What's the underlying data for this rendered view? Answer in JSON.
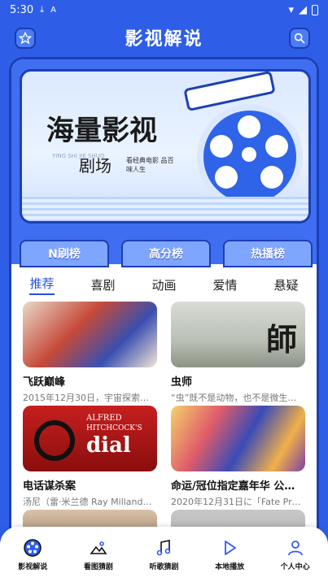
{
  "status": {
    "time": "5:30"
  },
  "header": {
    "title": "影视解说"
  },
  "banner": {
    "title": "海量影视",
    "subtitle": "剧场",
    "small": "看经典电影 品百味人生",
    "en": "YING SHI JIE SHUO"
  },
  "ranks": [
    {
      "label": "N刷榜"
    },
    {
      "label": "高分榜"
    },
    {
      "label": "热播榜"
    }
  ],
  "tabs": [
    "推荐",
    "喜剧",
    "动画",
    "爱情",
    "悬疑"
  ],
  "items": [
    {
      "title": "飞跃巅峰",
      "desc": "2015年12月30日，宇宙探索船Lu…"
    },
    {
      "title": "虫师",
      "desc": "“虫”既不是动物，也不是微生物…"
    },
    {
      "title": "电话谋杀案",
      "desc": "汤尼（雷·米兰德 Ray Milland饰）…"
    },
    {
      "title": "命运/冠位指定嘉年华 公…",
      "desc": "2020年12月31日に「Fate Projec…"
    }
  ],
  "thumb_text": {
    "mushishi": "師",
    "dial_line1": "ALFRED",
    "dial_line2": "HITCHCOCK'S",
    "dial_line3": "dial"
  },
  "nav": [
    {
      "label": "影视解说",
      "icon": "film-reel-icon"
    },
    {
      "label": "看图猜剧",
      "icon": "image-icon"
    },
    {
      "label": "听歌猜剧",
      "icon": "music-icon"
    },
    {
      "label": "本地播放",
      "icon": "play-icon"
    },
    {
      "label": "个人中心",
      "icon": "user-icon"
    }
  ],
  "colors": {
    "primary": "#2e5ee8",
    "accent": "#2350e0"
  }
}
